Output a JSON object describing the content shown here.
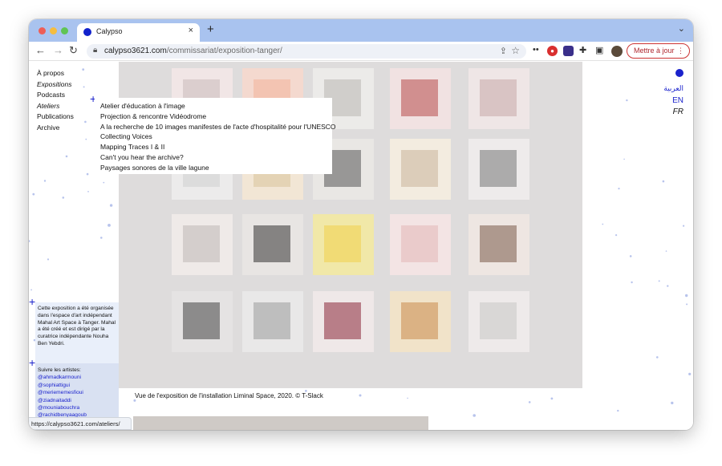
{
  "browser": {
    "tab_title": "Calypso",
    "tab_close": "×",
    "new_tab": "+",
    "tab_menu": "⌄",
    "url_domain": "calypso3621.com",
    "url_path": "/commissariat/exposition-tanger/",
    "update_label": "Mettre à jour",
    "update_menu": "⋮",
    "status_url": "https://calypso3621.com/ateliers/"
  },
  "nav": {
    "items": [
      {
        "label": "À propos"
      },
      {
        "label": "Expositions"
      },
      {
        "label": "Podcasts"
      },
      {
        "label": "Ateliers"
      },
      {
        "label": "Publications"
      },
      {
        "label": "Archive"
      }
    ]
  },
  "ateliers_menu": {
    "items": [
      "Atelier d'éducation à l'image",
      "Projection & rencontre Vidéodrome",
      "A la recherche de 10 images manifestes de l'acte d'hospitalité pour l'UNESCO",
      "Collecting Voices",
      "Mapping Traces I & II",
      "Can't you hear the archive?",
      "Paysages sonores de la ville lagune"
    ]
  },
  "languages": {
    "arabic": "العربية",
    "en": "EN",
    "fr": "FR"
  },
  "info": {
    "text": "Cette exposition a été organisée dans l'espace d'art indépendant Mahal Art Space à Tanger. Mahal a été créé et est dirigé par la curatrice indépendante Nouha Ben Yebdri.",
    "follow_heading": "Suivre les artistes:",
    "artists": [
      "@ahmadkarmouni",
      "@sophiattigui",
      "@meriememesfioui",
      "@ziadnaitaddi",
      "@mouniabouchra",
      "@rachidbenyaagoub"
    ]
  },
  "hero": {
    "caption": "Vue de l'exposition de l'installation Liminal Space, 2020. © T-Slack"
  },
  "colors": {
    "accent": "#1a22cc",
    "tab_strip": "#a9c3ef",
    "info_bg": "#e9effa",
    "follow_bg": "#d9e1f2"
  }
}
